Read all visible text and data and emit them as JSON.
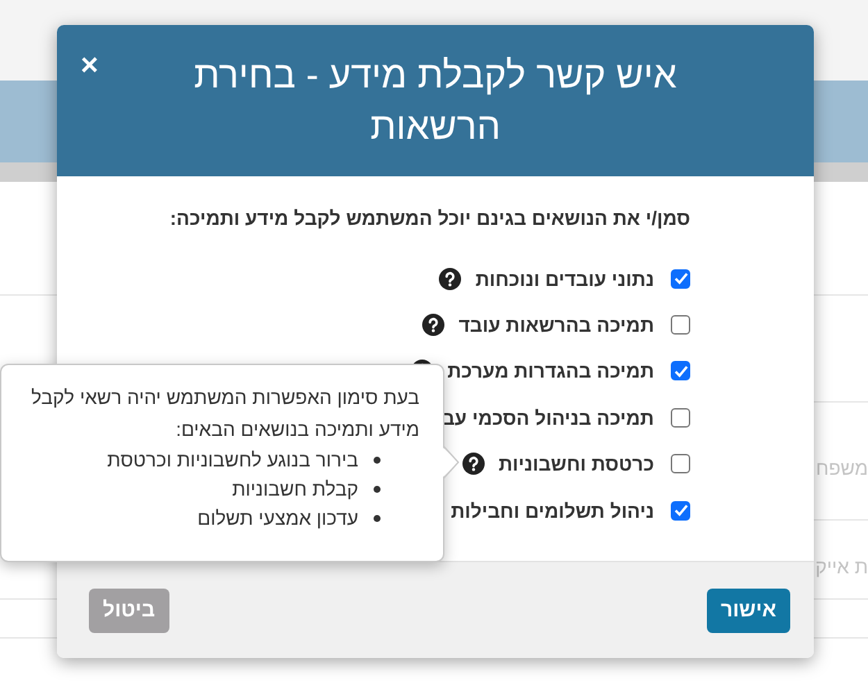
{
  "background": {
    "row_texts": [
      "משפח",
      "ת אייק"
    ]
  },
  "dialog": {
    "title": "איש קשר לקבלת מידע - בחירת הרשאות",
    "close": "×",
    "instruction": "סמן/י את הנושאים בגינם יוכל המשתמש לקבל מידע ותמיכה:",
    "permissions": [
      {
        "label": "נתוני עובדים ונוכחות",
        "checked": true,
        "help": true
      },
      {
        "label": "תמיכה בהרשאות עובד",
        "checked": false,
        "help": true
      },
      {
        "label": "תמיכה בהגדרות מערכת",
        "checked": true,
        "help": true
      },
      {
        "label": "תמיכה בניהול הסכמי עב",
        "checked": false,
        "help": false
      },
      {
        "label": "כרטסת וחשבוניות",
        "checked": false,
        "help": true
      },
      {
        "label": "ניהול תשלומים וחבילות",
        "checked": true,
        "help": false
      }
    ],
    "buttons": [
      {
        "label": "אישור",
        "kind": "primary"
      },
      {
        "label": "ביטול",
        "kind": "secondary"
      }
    ]
  },
  "tooltip": {
    "text": "בעת סימון האפשרות המשתמש יהיה רשאי לקבל מידע ותמיכה בנושאים הבאים:",
    "items": [
      "בירור בנוגע לחשבוניות וכרטסת",
      "קבלת חשבוניות",
      "עדכון אמצעי תשלום"
    ]
  }
}
